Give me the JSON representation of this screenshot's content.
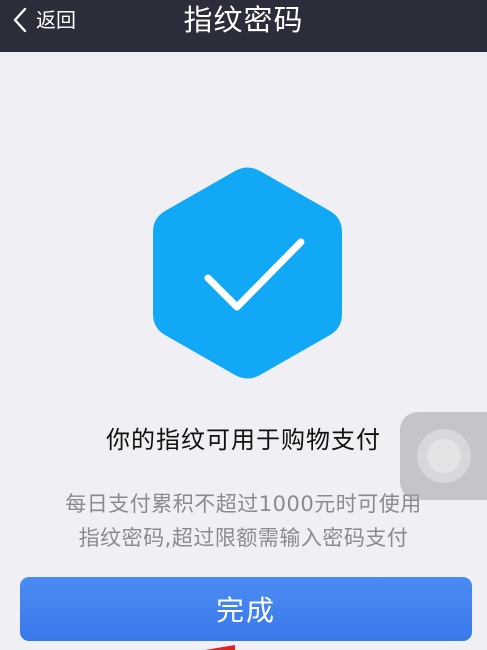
{
  "navbar": {
    "back_label": "返回",
    "title": "指纹密码",
    "icons": {
      "back": "chevron-left-icon"
    }
  },
  "success": {
    "icon": "checkmark-hexagon-icon",
    "color": "#11a8f5"
  },
  "message": "你的指纹可用于购物支付",
  "hint": {
    "line1": "每日支付累积不超过1000元时可使用",
    "line2": "指纹密码,超过限额需输入密码支付"
  },
  "actions": {
    "done_label": "完成",
    "done_color": "#3f82ee"
  },
  "colors": {
    "navbar_bg": "#2b2d3a",
    "page_bg": "#efeff4"
  }
}
